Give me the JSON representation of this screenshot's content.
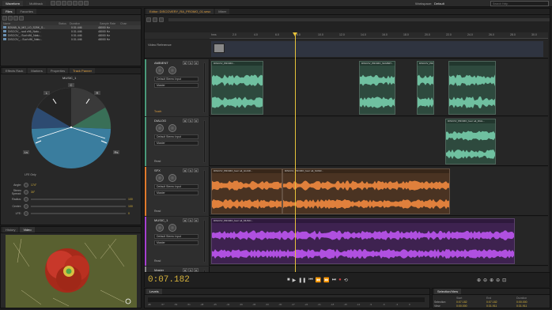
{
  "files_tabs": [
    "Files",
    "Favorites"
  ],
  "top_tabs": [
    "Waveform",
    "Multitrack"
  ],
  "workspace": {
    "label": "Workspace:",
    "value": "Default",
    "search_placeholder": "Search Help"
  },
  "editor_tabs": [
    "Editor: DISCOVERY_RA_PROMO_01.sesx",
    "Mixer"
  ],
  "files": {
    "columns": [
      "Name",
      "Status",
      "Duration",
      "Sample Rate",
      "Chan"
    ],
    "rows": [
      {
        "name": "B20AB_N_MO_LO_S25K_S...",
        "duration": "0:31.446",
        "rate": "48000 Hz"
      },
      {
        "name": "DISCOV_..sud v96_Natu...",
        "duration": "0:31.446",
        "rate": "48000 Hz"
      },
      {
        "name": "DISCOV_..Sud v96_Natu...",
        "duration": "0:31.446",
        "rate": "48000 Hz"
      },
      {
        "name": "DISCOV_...Sud v96_Natu...",
        "duration": "0:31.446",
        "rate": "48000 Hz"
      }
    ]
  },
  "mid_tabs": [
    "Effects Rack",
    "Markers",
    "Properties",
    "Track Panner"
  ],
  "panner": {
    "title": "MUSIC_1",
    "speakers": [
      "C",
      "L",
      "R",
      "Ls",
      "Rs"
    ],
    "lfe_label": "LFE Only",
    "params": [
      {
        "label": "Angle:",
        "value": "174°"
      },
      {
        "label": "Stereo Spread:",
        "value": "30°"
      },
      {
        "label": "Radius:",
        "value": "100"
      },
      {
        "label": "Center:",
        "value": "100"
      },
      {
        "label": "LFE:",
        "value": "0"
      }
    ]
  },
  "preview_tabs": [
    "History",
    "Video"
  ],
  "video_reference_label": "Video Reference",
  "ruler_labels": [
    "hms",
    "2.0",
    "4.0",
    "6.0",
    "8.0",
    "10.0",
    "12.0",
    "14.0",
    "16.0",
    "18.0",
    "20.0",
    "22.0",
    "24.0",
    "26.0",
    "28.0",
    "30.0"
  ],
  "tracks": [
    {
      "name": "AMBIENT",
      "input": "Default Stereo Input",
      "output": "Master",
      "mode": "Touch",
      "clips": [
        {
          "title": "DISCOV_PROMO..."
        },
        {
          "title": "DISCOV_PROMO_SUMMIT..."
        },
        {
          "title": "DISCOV_PROMO..."
        }
      ]
    },
    {
      "name": "DIALOG",
      "input": "Default Stereo Input",
      "output": "Master",
      "mode": "Read",
      "clips": [
        {
          "title": "DISCOV_PROMO_fourr alt_DIAL..."
        }
      ]
    },
    {
      "name": "SFX",
      "input": "Default Stereo Input",
      "output": "Master",
      "mode": "Read",
      "clips": [
        {
          "title": "DISCOV_PROMO_fourr alt_GUUR..."
        },
        {
          "title": "DISCOV_PROMO_fourr alt_SUNR..."
        }
      ]
    },
    {
      "name": "MUSIC_1",
      "input": "Default Stereo Input",
      "output": "Master",
      "mode": "Read",
      "clips": [
        {
          "title": "DISCOV_PROMO_fourr alt_MUSIC..."
        }
      ]
    },
    {
      "name": "Master",
      "input": "",
      "output": "",
      "mode": "Read",
      "clips": []
    }
  ],
  "transport": {
    "time": "0:07.182"
  },
  "levels": {
    "title": "Levels",
    "scale": [
      "dB",
      "-57",
      "-54",
      "-51",
      "-48",
      "-45",
      "-42",
      "-39",
      "-36",
      "-33",
      "-30",
      "-27",
      "-24",
      "-21",
      "-18",
      "-15",
      "-12",
      "-9",
      "-6",
      "-3",
      "0"
    ]
  },
  "selection": {
    "title": "Selection/View",
    "headers": [
      "",
      "Start",
      "End",
      "Duration"
    ],
    "rows": [
      [
        "Selection",
        "0:07.182",
        "0:07.182",
        "0:00.000"
      ],
      [
        "View",
        "0:00.000",
        "0:31.911",
        "0:31.911"
      ]
    ]
  },
  "colors": {
    "purple": "#a640d0",
    "orange": "#e07a2c",
    "green": "#4a9a7a",
    "teal": "#3a7d9e",
    "time": "#d7b33c"
  }
}
